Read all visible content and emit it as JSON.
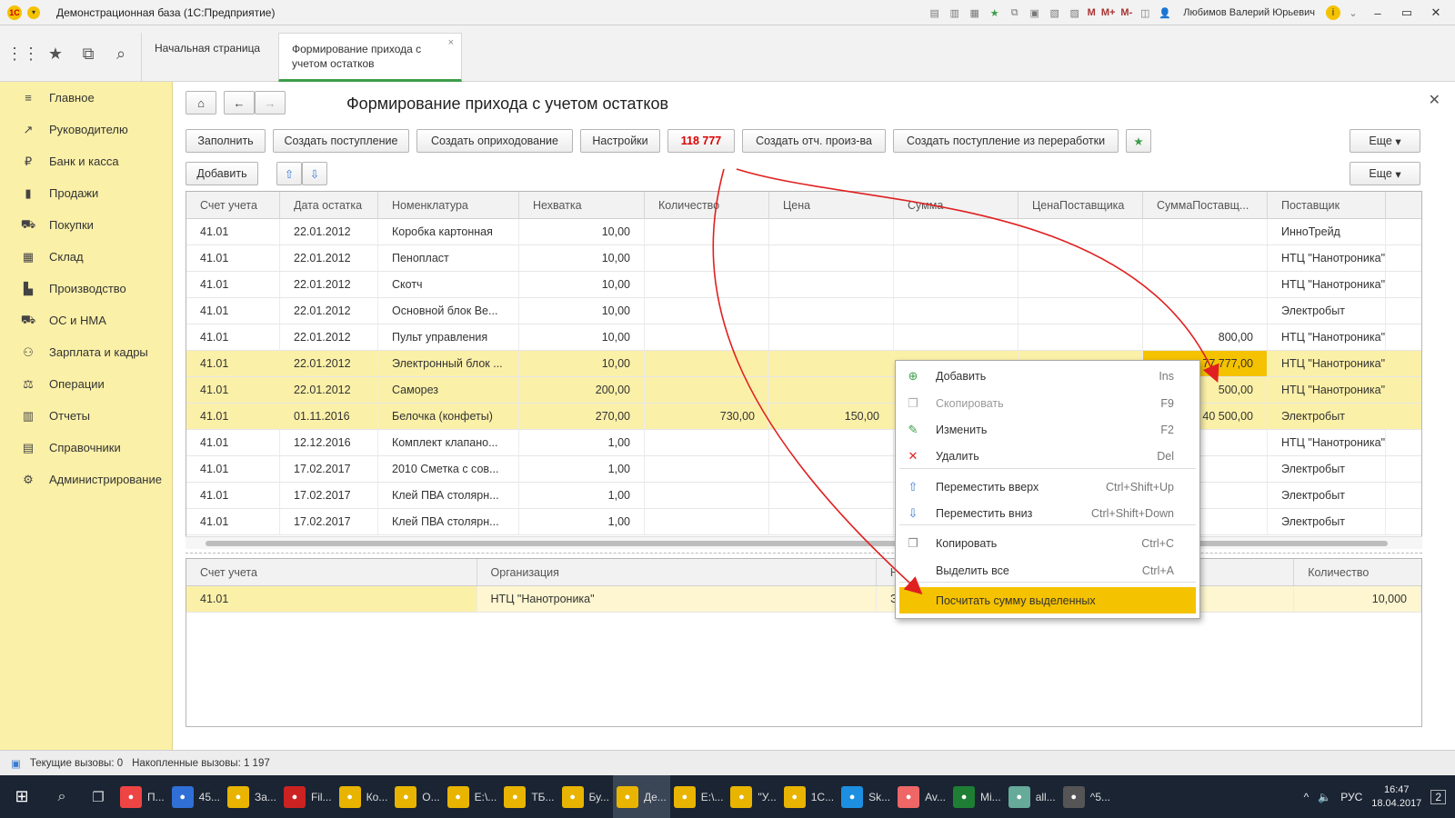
{
  "window": {
    "title": "Демонстрационная база  (1С:Предприятие)",
    "user": "Любимов Валерий Юрьевич",
    "m_buttons": [
      "M",
      "M+",
      "M-"
    ]
  },
  "tabs": [
    {
      "label": "Начальная страница"
    },
    {
      "label": "Формирование прихода с\nучетом остатков"
    }
  ],
  "sidebar": {
    "items": [
      {
        "label": "Главное",
        "icon": "menu-icon"
      },
      {
        "label": "Руководителю",
        "icon": "chart-line-icon"
      },
      {
        "label": "Банк и касса",
        "icon": "ruble-icon"
      },
      {
        "label": "Продажи",
        "icon": "bag-icon"
      },
      {
        "label": "Покупки",
        "icon": "cart-icon"
      },
      {
        "label": "Склад",
        "icon": "warehouse-icon"
      },
      {
        "label": "Производство",
        "icon": "factory-icon"
      },
      {
        "label": "ОС и НМА",
        "icon": "truck-icon"
      },
      {
        "label": "Зарплата и кадры",
        "icon": "people-icon"
      },
      {
        "label": "Операции",
        "icon": "scales-icon"
      },
      {
        "label": "Отчеты",
        "icon": "bar-chart-icon"
      },
      {
        "label": "Справочники",
        "icon": "book-icon"
      },
      {
        "label": "Администрирование",
        "icon": "gear-icon"
      }
    ]
  },
  "page": {
    "title": "Формирование прихода с учетом остатков"
  },
  "toolbar": {
    "fill": "Заполнить",
    "create_receipt": "Создать поступление",
    "create_posting": "Создать оприходование",
    "settings": "Настройки",
    "sum_value": "118 777",
    "create_report": "Создать отч. произ-ва",
    "create_from_processing": "Создать поступление из переработки",
    "more": "Еще",
    "add": "Добавить",
    "more2": "Еще"
  },
  "grid": {
    "columns": [
      "Счет учета",
      "Дата остатка",
      "Номенклатура",
      "Нехватка",
      "Количество",
      "Цена",
      "Сумма",
      "ЦенаПоставщика",
      "СуммаПоставщ...",
      "Поставщик"
    ],
    "rows": [
      {
        "account": "41.01",
        "date": "22.01.2012",
        "item": "Коробка картонная",
        "shortage": "10,00",
        "qty": "",
        "price": "",
        "sum": "",
        "sprice": "",
        "ssum": "",
        "supplier": "ИнноТрейд",
        "sel": false
      },
      {
        "account": "41.01",
        "date": "22.01.2012",
        "item": "Пенопласт",
        "shortage": "10,00",
        "qty": "",
        "price": "",
        "sum": "",
        "sprice": "",
        "ssum": "",
        "supplier": "НТЦ \"Нанотроника\"",
        "sel": false
      },
      {
        "account": "41.01",
        "date": "22.01.2012",
        "item": "Скотч",
        "shortage": "10,00",
        "qty": "",
        "price": "",
        "sum": "",
        "sprice": "",
        "ssum": "",
        "supplier": "НТЦ \"Нанотроника\"",
        "sel": false
      },
      {
        "account": "41.01",
        "date": "22.01.2012",
        "item": "Основной блок Ве...",
        "shortage": "10,00",
        "qty": "",
        "price": "",
        "sum": "",
        "sprice": "",
        "ssum": "",
        "supplier": "Электробыт",
        "sel": false
      },
      {
        "account": "41.01",
        "date": "22.01.2012",
        "item": "Пульт управления",
        "shortage": "10,00",
        "qty": "",
        "price": "",
        "sum": "",
        "sprice": "",
        "ssum": "800,00",
        "supplier": "НТЦ \"Нанотроника\"",
        "sel": false
      },
      {
        "account": "41.01",
        "date": "22.01.2012",
        "item": "Электронный блок ...",
        "shortage": "10,00",
        "qty": "",
        "price": "",
        "sum": "",
        "sprice": "",
        "ssum": "77 777,00",
        "supplier": "НТЦ \"Нанотроника\"",
        "sel": true,
        "hl": true
      },
      {
        "account": "41.01",
        "date": "22.01.2012",
        "item": "Саморез",
        "shortage": "200,00",
        "qty": "",
        "price": "",
        "sum": "",
        "sprice": "",
        "ssum": "500,00",
        "supplier": "НТЦ \"Нанотроника\"",
        "sel": true
      },
      {
        "account": "41.01",
        "date": "01.11.2016",
        "item": "Белочка (конфеты)",
        "shortage": "270,00",
        "qty": "730,00",
        "price": "150,00",
        "sum": "",
        "sprice": "",
        "ssum": "40 500,00",
        "supplier": "Электробыт",
        "sel": true
      },
      {
        "account": "41.01",
        "date": "12.12.2016",
        "item": "Комплект клапано...",
        "shortage": "1,00",
        "qty": "",
        "price": "",
        "sum": "",
        "sprice": "",
        "ssum": "",
        "supplier": "НТЦ \"Нанотроника\"",
        "sel": false
      },
      {
        "account": "41.01",
        "date": "17.02.2017",
        "item": "2010 Сметка с сов...",
        "shortage": "1,00",
        "qty": "",
        "price": "",
        "sum": "",
        "sprice": "",
        "ssum": "",
        "supplier": "Электробыт",
        "sel": false
      },
      {
        "account": "41.01",
        "date": "17.02.2017",
        "item": "Клей ПВА столярн...",
        "shortage": "1,00",
        "qty": "",
        "price": "",
        "sum": "",
        "sprice": "",
        "ssum": "",
        "supplier": "Электробыт",
        "sel": false
      },
      {
        "account": "41.01",
        "date": "17.02.2017",
        "item": "Клей ПВА столярн...",
        "shortage": "1,00",
        "qty": "",
        "price": "",
        "sum": "",
        "sprice": "",
        "ssum": "",
        "supplier": "Электробыт",
        "sel": false
      }
    ]
  },
  "grid2": {
    "columns": [
      "Счет учета",
      "Организация",
      "Н",
      "Количество"
    ],
    "row": {
      "account": "41.01",
      "org": "НТЦ \"Нанотроника\"",
      "n": "Э",
      "qty": "10,000"
    }
  },
  "context_menu": {
    "items": [
      {
        "label": "Добавить",
        "shortcut": "Ins",
        "icon": "add-icon"
      },
      {
        "label": "Скопировать",
        "shortcut": "F9",
        "icon": "copy-icon",
        "disabled": true
      },
      {
        "label": "Изменить",
        "shortcut": "F2",
        "icon": "pencil-icon"
      },
      {
        "label": "Удалить",
        "shortcut": "Del",
        "icon": "delete-icon"
      },
      {
        "label": "Переместить вверх",
        "shortcut": "Ctrl+Shift+Up",
        "icon": "arrow-up-icon"
      },
      {
        "label": "Переместить вниз",
        "shortcut": "Ctrl+Shift+Down",
        "icon": "arrow-down-icon"
      },
      {
        "label": "Копировать",
        "shortcut": "Ctrl+C",
        "icon": "clipboard-icon"
      },
      {
        "label": "Выделить все",
        "shortcut": "Ctrl+A",
        "icon": ""
      },
      {
        "label": "Посчитать сумму выделенных",
        "shortcut": "",
        "icon": ""
      }
    ]
  },
  "status": {
    "current_calls": "Текущие вызовы: 0",
    "accumulated_calls": "Накопленные вызовы: 1 197"
  },
  "taskbar": {
    "items": [
      "П...",
      "45...",
      "За...",
      "Fil...",
      "Ко...",
      "О...",
      "E:\\...",
      "ТБ...",
      "Бу...",
      "Де...",
      "E:\\...",
      "\"У...",
      "1С...",
      "Sk...",
      "Av...",
      "Mi...",
      "all...",
      "^5..."
    ],
    "lang": "РУС",
    "time": "16:47",
    "date": "18.04.2017",
    "notif": "2"
  },
  "colors": {
    "accent_yellow": "#f5c200",
    "sidebar_bg": "#fbf0a8",
    "arrow_red": "#e02020"
  }
}
